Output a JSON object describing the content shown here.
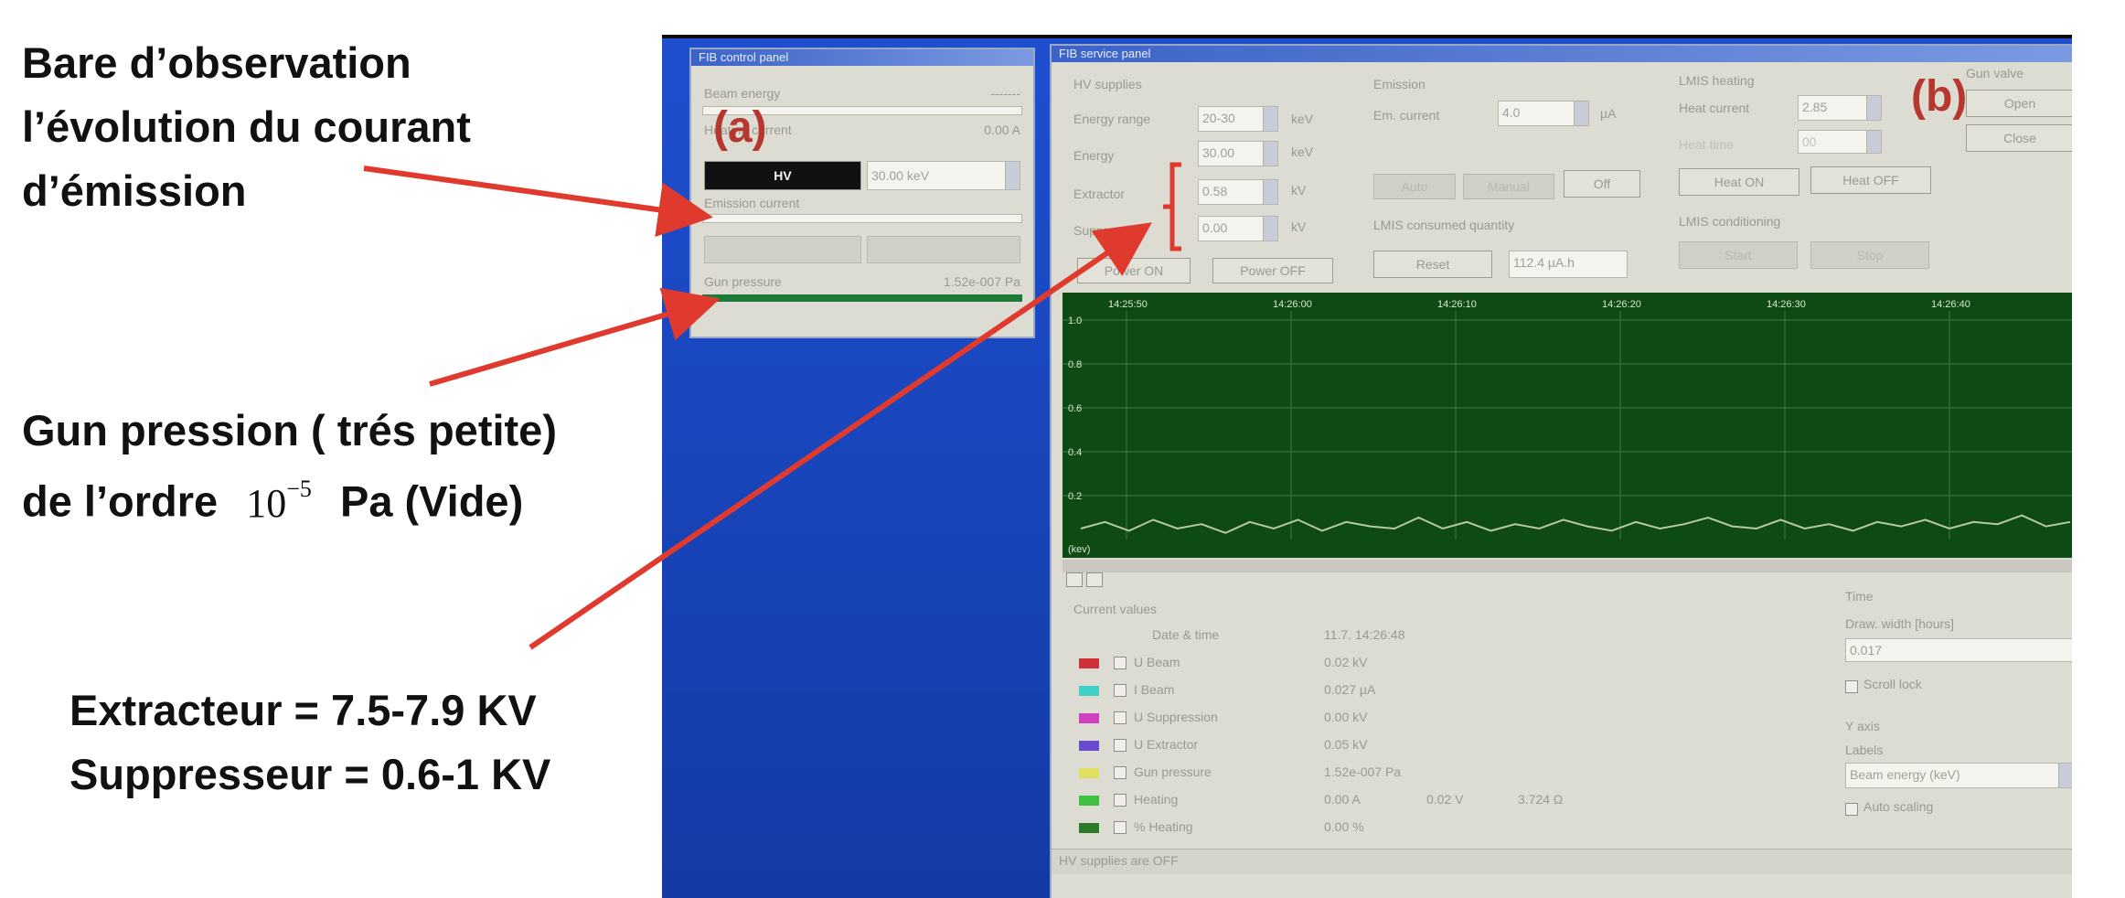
{
  "annotations": {
    "top_left": [
      "Bare d’observation",
      "l’évolution du courant",
      "d’émission"
    ],
    "gun_line1": "Gun pression ( trés petite)",
    "gun_line2_prefix": "de l’ordre",
    "gun_exponent_base": "10",
    "gun_exponent_power": "−5",
    "gun_line2_suffix": "Pa (Vide)",
    "extracteur": "Extracteur = 7.5-7.9 KV",
    "suppresseur": "Suppresseur = 0.6-1 KV",
    "label_a": "(a)",
    "label_b": "(b)"
  },
  "colors": {
    "annotation_red": "#b5372e",
    "arrow_red": "#e03a2e",
    "desktop_blue": "#1a48c0",
    "plot_green": "#0d4a14",
    "trace": "#b8c8a0",
    "hv_button": "#111111"
  },
  "control_panel": {
    "title": "FIB control panel",
    "beam_energy_label": "Beam energy",
    "beam_energy_value": "-------",
    "heating_current_label": "Heating current",
    "heating_current_value": "0.00 A",
    "hv_button": "HV",
    "hv_value": "30.00 keV",
    "emission_current_label": "Emission current",
    "gun_pressure_label": "Gun pressure",
    "gun_pressure_value": "1.52e-007 Pa"
  },
  "service_panel": {
    "title": "FIB service panel",
    "hv_supplies_label": "HV supplies",
    "energy_range_label": "Energy range",
    "energy_range_value": "20-30",
    "energy_label": "Energy",
    "energy_value": "30.00",
    "extractor_label": "Extractor",
    "extractor_value": "0.58",
    "suppressor_label": "Suppressor",
    "suppressor_value": "0.00",
    "unit_kev": "keV",
    "unit_kv": "kV",
    "power_on": "Power ON",
    "power_off": "Power OFF",
    "emission_label": "Emission",
    "em_current_label": "Em. current",
    "em_current_value": "4.0",
    "unit_ua": "µA",
    "auto_button": "Auto",
    "manual_button": "Manual",
    "off_button": "Off",
    "lmis_consumed_label": "LMIS consumed quantity",
    "reset_button": "Reset",
    "consumed_value": "112.4 µA.h",
    "lmis_heating_label": "LMIS heating",
    "heat_current_label": "Heat current",
    "heat_current_value": "2.85",
    "heat_time_label": "Heat time",
    "heat_time_value": "00",
    "heat_on": "Heat ON",
    "heat_off": "Heat OFF",
    "lmis_conditioning_label": "LMIS conditioning",
    "start_button": "Start",
    "stop_button": "Stop",
    "gun_valve_label": "Gun valve",
    "open_button": "Open",
    "close_button": "Close"
  },
  "chart_data": {
    "type": "line",
    "x": [
      "14:25:50",
      "14:26:00",
      "14:26:10",
      "14:26:20",
      "14:26:30",
      "14:26:40"
    ],
    "yticks": [
      "1.0",
      "0.8",
      "0.6",
      "0.4",
      "0.2"
    ],
    "ylim": [
      0,
      1.0
    ],
    "ylabel": "(kev)",
    "series": [
      {
        "values": [
          0.05,
          0.08,
          0.04,
          0.09,
          0.05,
          0.07,
          0.03,
          0.08,
          0.05,
          0.09,
          0.04,
          0.08,
          0.06,
          0.05,
          0.1,
          0.05,
          0.08,
          0.04,
          0.07,
          0.05,
          0.09,
          0.06,
          0.04,
          0.08,
          0.05,
          0.07,
          0.1,
          0.06,
          0.05,
          0.09,
          0.05,
          0.07,
          0.04,
          0.08,
          0.06,
          0.09,
          0.05,
          0.08,
          0.07,
          0.11,
          0.06,
          0.08
        ]
      }
    ]
  },
  "current_values": {
    "title": "Current values",
    "datetime_label": "Date & time",
    "datetime_value": "11.7. 14:26:48",
    "rows": [
      {
        "name": "U Beam",
        "value": "0.02 kV",
        "extra1": "",
        "extra2": "",
        "color": "#d0303a"
      },
      {
        "name": "I Beam",
        "value": "0.027 µA",
        "extra1": "",
        "extra2": "",
        "color": "#40d0c8"
      },
      {
        "name": "U Suppression",
        "value": "0.00 kV",
        "extra1": "",
        "extra2": "",
        "color": "#d040c0"
      },
      {
        "name": "U Extractor",
        "value": "0.05 kV",
        "extra1": "",
        "extra2": "",
        "color": "#6a4ad0"
      },
      {
        "name": "Gun pressure",
        "value": "1.52e-007 Pa",
        "extra1": "",
        "extra2": "",
        "color": "#e0e060"
      },
      {
        "name": "Heating",
        "value": "0.00 A",
        "extra1": "0.02 V",
        "extra2": "3.724 Ω",
        "color": "#40c040"
      },
      {
        "name": "% Heating",
        "value": "0.00 %",
        "extra1": "",
        "extra2": "",
        "color": "#2a7a2a"
      }
    ]
  },
  "time_panel": {
    "title": "Time",
    "draw_width_label": "Draw. width [hours]",
    "draw_width_value": "0.017",
    "scroll_lock": "Scroll lock",
    "y_axis_label": "Y axis",
    "labels_label": "Labels",
    "labels_value": "Beam energy (keV)",
    "auto_scaling": "Auto scaling"
  },
  "status_bar": "HV supplies are OFF"
}
